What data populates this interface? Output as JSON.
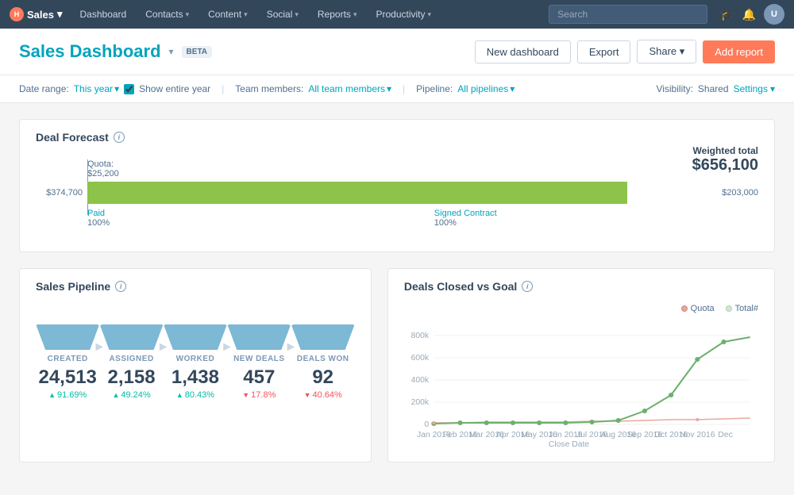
{
  "topnav": {
    "logo": "Sales",
    "items": [
      {
        "label": "Dashboard",
        "hasDropdown": false
      },
      {
        "label": "Contacts",
        "hasDropdown": true
      },
      {
        "label": "Content",
        "hasDropdown": true
      },
      {
        "label": "Social",
        "hasDropdown": true
      },
      {
        "label": "Reports",
        "hasDropdown": true
      },
      {
        "label": "Productivity",
        "hasDropdown": true
      }
    ],
    "search_placeholder": "Search",
    "avatar_initials": "U"
  },
  "header": {
    "title": "Sales Dashboard",
    "beta_label": "Beta",
    "buttons": {
      "new_dashboard": "New dashboard",
      "export": "Export",
      "share": "Share",
      "add_report": "Add report"
    }
  },
  "filters": {
    "date_range_label": "Date range:",
    "date_range_value": "This year",
    "show_entire_year_label": "Show entire year",
    "team_members_label": "Team members:",
    "team_members_value": "All team members",
    "pipeline_label": "Pipeline:",
    "pipeline_value": "All pipelines",
    "visibility_label": "Visibility:",
    "visibility_value": "Shared",
    "settings_label": "Settings"
  },
  "deal_forecast": {
    "title": "Deal Forecast",
    "weighted_label": "Weighted total",
    "weighted_value": "$656,100",
    "quota_label": "Quota:",
    "quota_amount": "$25,200",
    "bar1": {
      "left_amount": "$374,700",
      "right_amount": "$203,000",
      "width_pct": 86,
      "label": "Paid",
      "pct": "100%",
      "label2": "Signed Contract",
      "pct2": "100%"
    }
  },
  "sales_pipeline": {
    "title": "Sales Pipeline",
    "stats": [
      {
        "col_label": "CREATED",
        "value": "24,513",
        "delta": "91.69%",
        "up": true
      },
      {
        "col_label": "ASSIGNED",
        "value": "2,158",
        "delta": "49.24%",
        "up": true
      },
      {
        "col_label": "WORKED",
        "value": "1,438",
        "delta": "80.43%",
        "up": true
      },
      {
        "col_label": "NEW DEALS",
        "value": "457",
        "delta": "17.8%",
        "up": false
      },
      {
        "col_label": "DEALS WON",
        "value": "92",
        "delta": "40.64%",
        "up": false
      }
    ]
  },
  "deals_closed": {
    "title": "Deals Closed vs Goal",
    "legend": {
      "quota_label": "Quota",
      "total_label": "Total#"
    },
    "y_labels": [
      "800k",
      "600k",
      "400k",
      "200k",
      "0"
    ],
    "x_labels": [
      "Jan 2016",
      "Feb 2016",
      "Mar 2016",
      "Apr 2016",
      "May 2016",
      "Jun 2016",
      "Jul 2016",
      "Aug 2016",
      "Sep 2016",
      "Oct 2016",
      "Nov 2016",
      "Dec"
    ],
    "x_axis_title": "Close Date"
  }
}
